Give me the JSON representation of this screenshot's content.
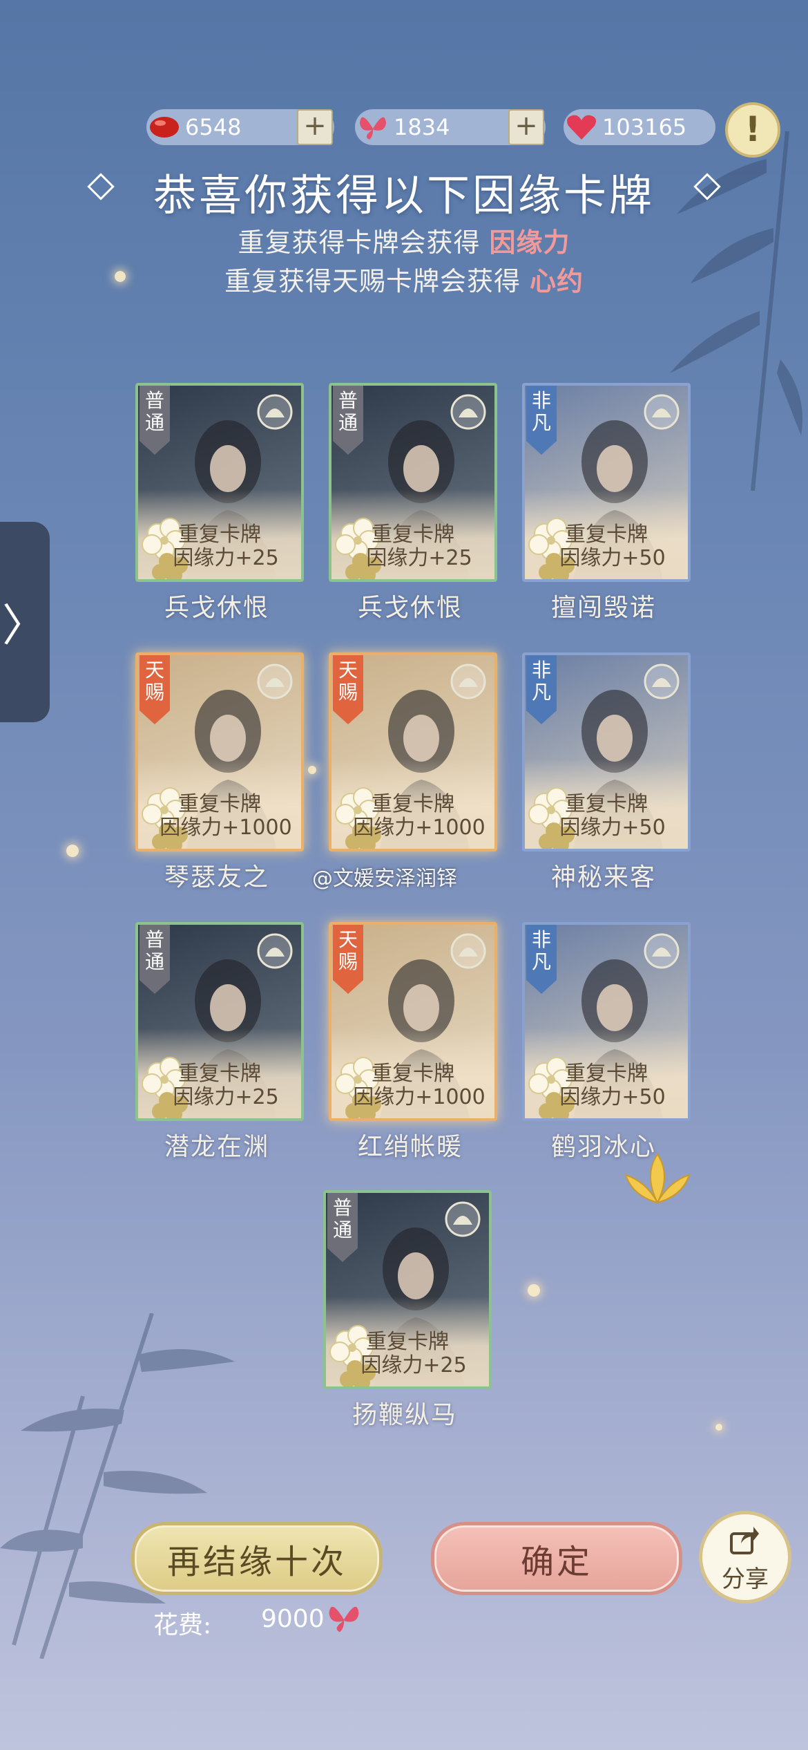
{
  "currencies": [
    {
      "icon": "red-bean-icon",
      "value": "6548",
      "has_plus": true
    },
    {
      "icon": "butterfly-icon",
      "value": "1834",
      "has_plus": true
    },
    {
      "icon": "heart-icon",
      "value": "103165",
      "has_plus": false
    }
  ],
  "title": "恭喜你获得以下因缘卡牌",
  "subtitles": [
    {
      "prefix": "重复获得卡牌会获得",
      "highlight": "因缘力"
    },
    {
      "prefix": "重复获得天赐卡牌会获得",
      "highlight": "心约"
    }
  ],
  "cards": [
    {
      "rarity": "普通",
      "rarity_class": "common",
      "dup_line1": "重复卡牌",
      "dup_line2": "因缘力+25",
      "name": "兵戈休恨"
    },
    {
      "rarity": "普通",
      "rarity_class": "common",
      "dup_line1": "重复卡牌",
      "dup_line2": "因缘力+25",
      "name": "兵戈休恨"
    },
    {
      "rarity": "非凡",
      "rarity_class": "rare",
      "dup_line1": "重复卡牌",
      "dup_line2": "因缘力+50",
      "name": "擅闯毁诺"
    },
    {
      "rarity": "天赐",
      "rarity_class": "gift",
      "dup_line1": "重复卡牌",
      "dup_line2": "因缘力+1000",
      "name": "琴瑟友之"
    },
    {
      "rarity": "天赐",
      "rarity_class": "gift",
      "dup_line1": "重复卡牌",
      "dup_line2": "因缘力+1000",
      "name": ""
    },
    {
      "rarity": "非凡",
      "rarity_class": "rare",
      "dup_line1": "重复卡牌",
      "dup_line2": "因缘力+50",
      "name": "神秘来客"
    },
    {
      "rarity": "普通",
      "rarity_class": "common",
      "dup_line1": "重复卡牌",
      "dup_line2": "因缘力+25",
      "name": "潜龙在渊"
    },
    {
      "rarity": "天赐",
      "rarity_class": "gift",
      "dup_line1": "重复卡牌",
      "dup_line2": "因缘力+1000",
      "name": "红绡帐暖"
    },
    {
      "rarity": "非凡",
      "rarity_class": "rare",
      "dup_line1": "重复卡牌",
      "dup_line2": "因缘力+50",
      "name": "鹤羽冰心"
    },
    {
      "rarity": "普通",
      "rarity_class": "common",
      "dup_line1": "重复卡牌",
      "dup_line2": "因缘力+25",
      "name": "扬鞭纵马"
    }
  ],
  "watermark": "@文媛安泽润铎",
  "buttons": {
    "again": "再结缘十次",
    "confirm": "确定",
    "share": "分享"
  },
  "cost": {
    "label": "花费:",
    "value": "9000",
    "icon": "butterfly-icon"
  },
  "side_tab": {
    "icon": "chevron-right-icon",
    "glyph": "〉"
  },
  "warning": {
    "icon": "exclamation-icon",
    "glyph": "!"
  },
  "colors": {
    "highlight": "#f29a9a",
    "common": "#6e6e78",
    "rare": "#4f79b6",
    "gift": "#e0653f"
  }
}
